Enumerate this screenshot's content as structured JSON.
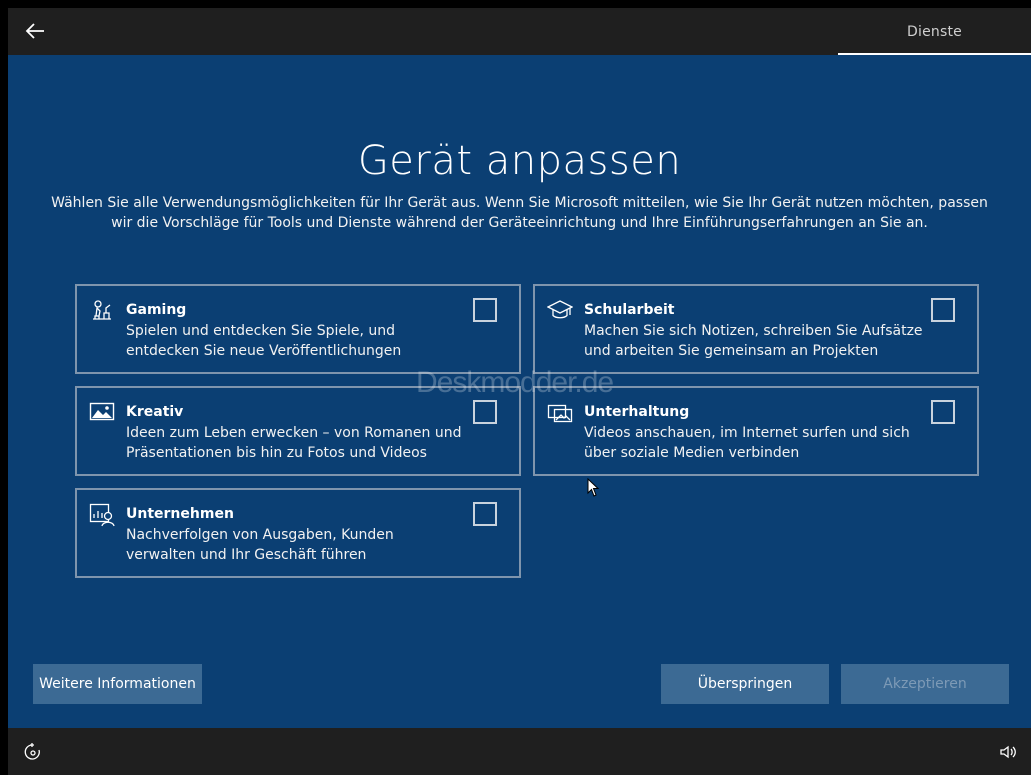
{
  "header": {
    "tab_label": "Dienste"
  },
  "page": {
    "title": "Gerät anpassen",
    "subtitle": "Wählen Sie alle Verwendungsmöglichkeiten für Ihr Gerät aus. Wenn Sie Microsoft mitteilen, wie Sie Ihr Gerät nutzen möchten, passen wir die Vorschläge für Tools und Dienste während der Geräteeinrichtung und Ihre Einführungserfahrungen an Sie an."
  },
  "options": [
    {
      "name": "Gaming",
      "description": "Spielen und entdecken Sie Spiele, und entdecken Sie neue Veröffentlichungen",
      "icon": "gaming-icon",
      "checked": false
    },
    {
      "name": "Schularbeit",
      "description": "Machen Sie sich Notizen, schreiben Sie Aufsätze und arbeiten Sie gemeinsam an Projekten",
      "icon": "graduation-cap-icon",
      "checked": false
    },
    {
      "name": "Kreativ",
      "description": "Ideen zum Leben erwecken – von Romanen und Präsentationen bis hin zu Fotos und Videos",
      "icon": "picture-icon",
      "checked": false
    },
    {
      "name": "Unterhaltung",
      "description": "Videos anschauen, im Internet surfen und sich über soziale Medien verbinden",
      "icon": "media-icon",
      "checked": false
    },
    {
      "name": "Unternehmen",
      "description": "Nachverfolgen von Ausgaben, Kunden verwalten und Ihr Geschäft führen",
      "icon": "business-icon",
      "checked": false
    }
  ],
  "watermark": "Deskmodder.de",
  "buttons": {
    "more": "Weitere Informationen",
    "skip": "Überspringen",
    "accept": "Akzeptieren"
  },
  "colors": {
    "background": "#0b3f73",
    "bar": "#1f1f1f",
    "button": "#3c6a94",
    "card_border": "#7f95ad"
  }
}
